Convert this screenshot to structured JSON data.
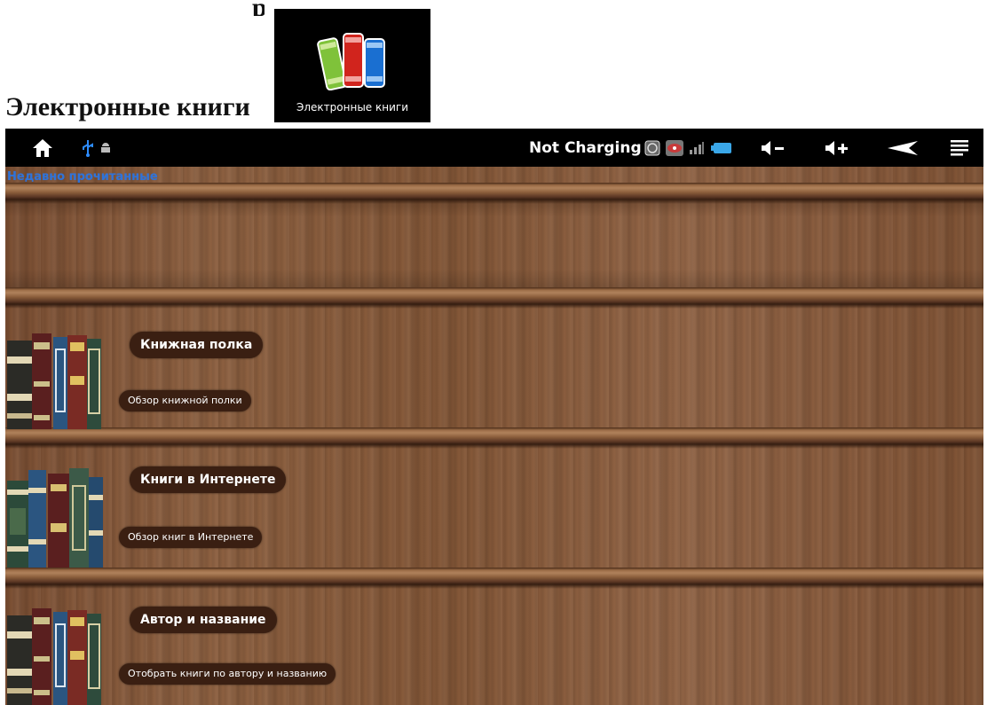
{
  "document": {
    "heading": "Электронные книги"
  },
  "app_tile": {
    "label": "Электронные книги",
    "icon": "books-app-icon"
  },
  "status_bar": {
    "icons": [
      "home-icon",
      "usb-icon",
      "android-debug-icon",
      "cast-icon",
      "eye-icon",
      "signal-icon",
      "battery-icon",
      "volume-down-icon",
      "volume-up-icon",
      "back-icon",
      "menu-icon"
    ],
    "status_text": "Not Charging",
    "colors": {
      "background": "#000000",
      "usb": "#2d8cff",
      "battery": "#3aa7e8"
    }
  },
  "bookshelf": {
    "recent_label": "Недавно прочитанные",
    "shelves": [
      {
        "title": "Книжная полка",
        "subtitle": "Обзор книжной полки"
      },
      {
        "title": "Книги в Интернете",
        "subtitle": "Обзор книг в Интернете"
      },
      {
        "title": "Автор и название",
        "subtitle": "Отобрать книги по автору и названию"
      }
    ],
    "colors": {
      "wood": "#8a5c3c",
      "pill": "#3a1f12",
      "recent_label": "#2f73d9"
    }
  }
}
